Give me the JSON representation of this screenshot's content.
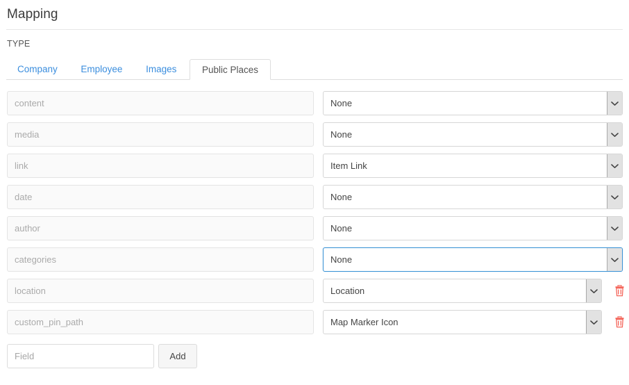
{
  "header": {
    "title": "Mapping"
  },
  "type_section": {
    "label": "TYPE",
    "tabs": [
      {
        "label": "Company",
        "active": false
      },
      {
        "label": "Employee",
        "active": false
      },
      {
        "label": "Images",
        "active": false
      },
      {
        "label": "Public Places",
        "active": true
      }
    ]
  },
  "mapping_rows": [
    {
      "field_placeholder": "content",
      "mapped_value": "None",
      "focused": false,
      "deletable": false
    },
    {
      "field_placeholder": "media",
      "mapped_value": "None",
      "focused": false,
      "deletable": false
    },
    {
      "field_placeholder": "link",
      "mapped_value": "Item Link",
      "focused": false,
      "deletable": false
    },
    {
      "field_placeholder": "date",
      "mapped_value": "None",
      "focused": false,
      "deletable": false
    },
    {
      "field_placeholder": "author",
      "mapped_value": "None",
      "focused": false,
      "deletable": false
    },
    {
      "field_placeholder": "categories",
      "mapped_value": "None",
      "focused": true,
      "deletable": false
    },
    {
      "field_placeholder": "location",
      "mapped_value": "Location",
      "focused": false,
      "deletable": true
    },
    {
      "field_placeholder": "custom_pin_path",
      "mapped_value": "Map Marker Icon",
      "focused": false,
      "deletable": true
    }
  ],
  "add_row": {
    "field_placeholder": "Field",
    "button_label": "Add"
  },
  "icons": {
    "dropdown": "chevron-down-icon",
    "delete": "trash-icon"
  },
  "colors": {
    "tab_link": "#3b8ede",
    "focus_border": "#3b93d6",
    "delete_icon": "#f4655a",
    "text": "#333333"
  }
}
